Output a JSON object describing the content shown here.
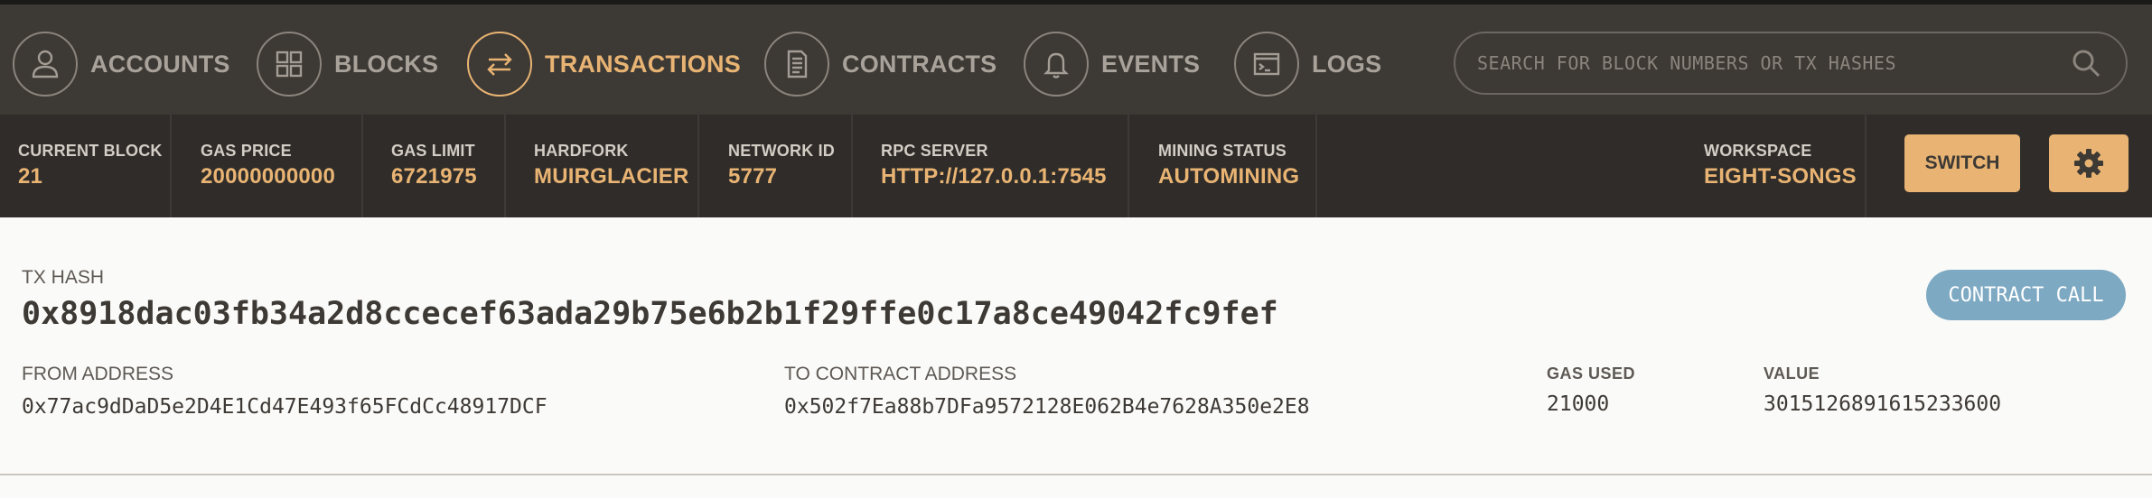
{
  "nav": {
    "items": [
      {
        "label": "ACCOUNTS",
        "icon": "user-icon"
      },
      {
        "label": "BLOCKS",
        "icon": "grid-icon"
      },
      {
        "label": "TRANSACTIONS",
        "icon": "swap-arrows-icon"
      },
      {
        "label": "CONTRACTS",
        "icon": "document-icon"
      },
      {
        "label": "EVENTS",
        "icon": "bell-icon"
      },
      {
        "label": "LOGS",
        "icon": "terminal-icon"
      }
    ],
    "active": "TRANSACTIONS",
    "search_placeholder": "SEARCH FOR BLOCK NUMBERS OR TX HASHES"
  },
  "status": {
    "current_block": {
      "label": "CURRENT BLOCK",
      "value": "21"
    },
    "gas_price": {
      "label": "GAS PRICE",
      "value": "20000000000"
    },
    "gas_limit": {
      "label": "GAS LIMIT",
      "value": "6721975"
    },
    "hardfork": {
      "label": "HARDFORK",
      "value": "MUIRGLACIER"
    },
    "network_id": {
      "label": "NETWORK ID",
      "value": "5777"
    },
    "rpc_server": {
      "label": "RPC SERVER",
      "value": "HTTP://127.0.0.1:7545"
    },
    "mining_status": {
      "label": "MINING STATUS",
      "value": "AUTOMINING"
    },
    "workspace": {
      "label": "WORKSPACE",
      "value": "EIGHT-SONGS"
    },
    "switch_label": "SWITCH"
  },
  "tx": {
    "hash_label": "TX HASH",
    "hash": "0x8918dac03fb34a2d8ccecef63ada29b75e6b2b1f29ffe0c17a8ce49042fc9fef",
    "type_badge": "CONTRACT CALL",
    "from_label": "FROM ADDRESS",
    "from": "0x77ac9dDaD5e2D4E1Cd47E493f65FCdCc48917DCF",
    "to_label": "TO CONTRACT ADDRESS",
    "to": "0x502f7Ea88b7DFa9572128E062B4e7628A350e2E8",
    "gas_used_label": "GAS USED",
    "gas_used": "21000",
    "value_label": "VALUE",
    "value": "3015126891615233600"
  },
  "colors": {
    "accent": "#e9b473",
    "nav_bg": "#3d3935",
    "status_bg": "#2f2c29",
    "badge": "#7ea9c3"
  }
}
